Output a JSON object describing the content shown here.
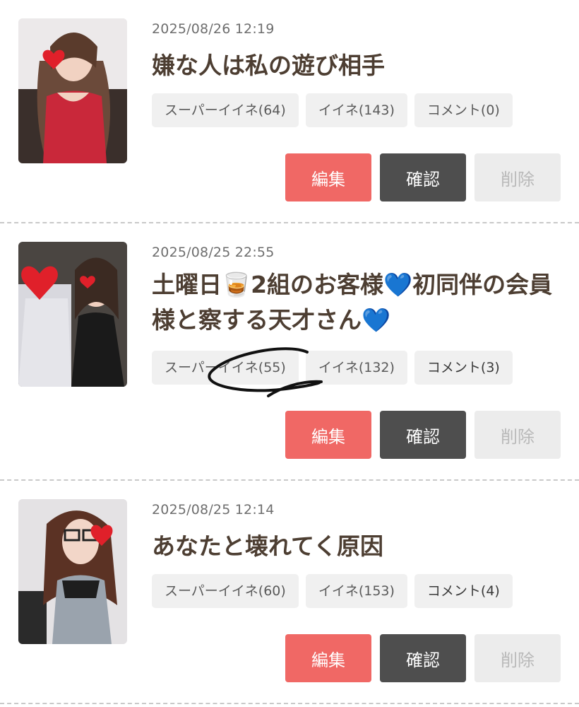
{
  "posts": [
    {
      "date": "2025/08/26 12:19",
      "title": "嫌な人は私の遊び相手",
      "super_like": "スーパーイイネ(64)",
      "like": "イイネ(143)",
      "comment": "コメント(0)",
      "edit": "編集",
      "confirm": "確認",
      "delete": "削除"
    },
    {
      "date": "2025/08/25 22:55",
      "title": "土曜日🥃2組のお客様💙初同伴の会員様と察する天才さん💙",
      "super_like": "スーパーイイネ(55)",
      "like": "イイネ(132)",
      "comment": "コメント(3)",
      "edit": "編集",
      "confirm": "確認",
      "delete": "削除"
    },
    {
      "date": "2025/08/25 12:14",
      "title": "あなたと壊れてく原因",
      "super_like": "スーパーイイネ(60)",
      "like": "イイネ(153)",
      "comment": "コメント(4)",
      "edit": "編集",
      "confirm": "確認",
      "delete": "削除"
    }
  ],
  "colors": {
    "edit_button": "#f06865",
    "confirm_button": "#4e4e4e",
    "delete_button": "#ececec",
    "tag_background": "#f0f0f0",
    "title_text": "#4d3e32"
  },
  "icons": [
    "heart-sticker-icon",
    "whisky-glass-emoji",
    "blue-heart-emoji"
  ]
}
